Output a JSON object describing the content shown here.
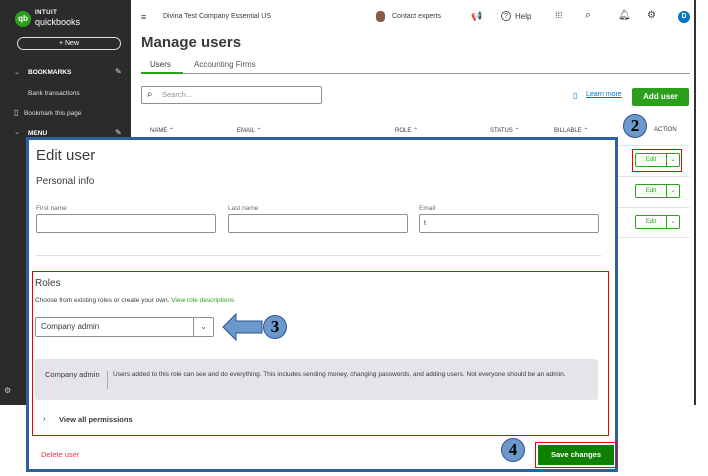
{
  "sidebar": {
    "logo_brand": "INTUIT",
    "logo_product": "quickbooks",
    "new_label": "+ New",
    "bookmarks_label": "BOOKMARKS",
    "items": [
      "Bank transactions",
      "Bookmark this page"
    ],
    "menu_label": "MENU"
  },
  "topbar": {
    "company": "Divina Test Company Essential US",
    "contact": "Contact experts",
    "help": "Help",
    "avatar_letter": "D"
  },
  "page": {
    "title": "Manage users",
    "tabs": [
      "Users",
      "Accounting Firms"
    ],
    "search_placeholder": "Search...",
    "learn_more": "Learn more",
    "add_user": "Add user",
    "columns": [
      "NAME ⌃",
      "EMAIL ⌃",
      "ROLE ⌃",
      "STATUS ⌃",
      "BILLABLE ⌃",
      "ACTION"
    ],
    "edit_label": "Edit"
  },
  "modal": {
    "title": "Edit user",
    "personal_info": "Personal info",
    "fields": {
      "first_name_label": "First name",
      "last_name_label": "Last name",
      "email_label": "Email",
      "first_name_value": "",
      "last_name_value": "",
      "email_value": "t"
    },
    "roles_title": "Roles",
    "roles_desc": "Choose from existing roles or create your own.",
    "role_desc_link": "View role descriptions",
    "role_selected": "Company admin",
    "role_name": "Company admin",
    "role_description": "Users added to this role can see and do everything. This includes sending money, changing passwords, and adding users. Not everyone should be an admin.",
    "view_permissions": "View all permissions",
    "delete_user": "Delete user",
    "save_changes": "Save changes"
  },
  "callouts": [
    "2",
    "3",
    "4"
  ],
  "colors": {
    "brand_green": "#2ca01c",
    "save_green": "#108000",
    "highlight_red": "#ee0000",
    "callout_blue": "#6c99cc",
    "modal_border": "#2e5f9e"
  }
}
